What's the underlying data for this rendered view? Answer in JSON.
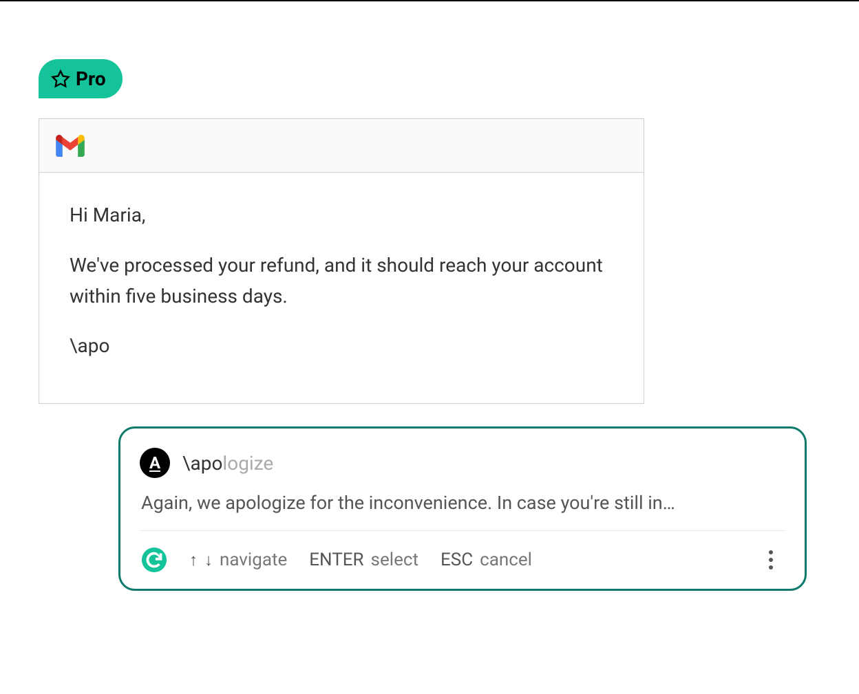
{
  "badge": {
    "label": "Pro"
  },
  "email": {
    "greeting": "Hi Maria,",
    "body": "We've processed your refund, and it should reach your account within five business days.",
    "typed": "\\apo"
  },
  "snippet": {
    "icon_letter": "A",
    "command_prefix": "\\apo",
    "command_suffix": "logize",
    "preview": "Again, we apologize for the inconvenience. In case you're still in…"
  },
  "footer": {
    "arrow_up": "↑",
    "arrow_down": "↓",
    "navigate_label": "navigate",
    "enter_key": "ENTER",
    "select_label": "select",
    "esc_key": "ESC",
    "cancel_label": "cancel"
  }
}
